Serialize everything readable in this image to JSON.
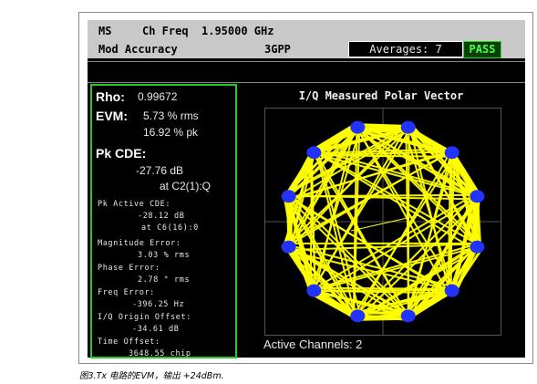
{
  "header": {
    "mode": "MS",
    "freq_label": "Ch Freq",
    "freq_value": "1.95000 GHz",
    "measurement": "Mod Accuracy",
    "standard": "3GPP",
    "averages": "Averages: 7",
    "status": "PASS"
  },
  "results": {
    "rho_label": "Rho:",
    "rho_value": "0.99672",
    "evm_label": "EVM:",
    "evm_rms": "5.73 % rms",
    "evm_pk": "16.92 % pk",
    "pkcde_label": "Pk CDE:",
    "pkcde_value": "-27.76 dB",
    "pkcde_at": "at C2(1):Q",
    "pk_active_label": "Pk Active CDE:",
    "pk_active_value": "-28.12 dB",
    "pk_active_at": "at C6(16):0",
    "mag_label": "Magnitude Error:",
    "mag_value": "3.03 % rms",
    "phase_label": "Phase Error:",
    "phase_value": "2.78 ° rms",
    "freq_label": "Freq Error:",
    "freq_value": "-396.25 Hz",
    "iq_label": "I/Q Origin Offset:",
    "iq_value": "-34.61 dB",
    "time_label": "Time Offset:",
    "time_value": "3648.55 chip"
  },
  "plot": {
    "title": "I/Q Measured Polar Vector",
    "channels": "Active Channels: 2",
    "trace_color": "#ffff00",
    "point_color": "#2233ff",
    "grid_color": "#666666"
  },
  "caption": "图3.Tx 电路的EVM，输出 +24dBm."
}
